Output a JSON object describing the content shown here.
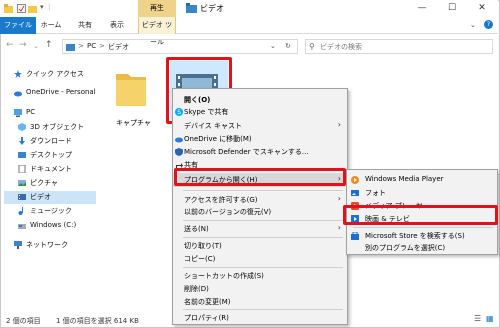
{
  "window": {
    "title": "ビデオ",
    "context_tab": "再生",
    "controls": [
      "—",
      "☐",
      "✕"
    ]
  },
  "ribbon": {
    "tabs": [
      "ファイル",
      "ホーム",
      "共有",
      "表示",
      "ビデオ ツール"
    ],
    "help": "?"
  },
  "address": {
    "path": [
      "PC",
      "ビデオ"
    ],
    "separator": ">",
    "search_placeholder": "ビデオの検索"
  },
  "sidebar": {
    "items": [
      {
        "label": "クイック アクセス",
        "icon": "star-icon"
      },
      {
        "label": "OneDrive - Personal",
        "icon": "cloud-icon"
      },
      {
        "label": "PC",
        "icon": "pc-icon"
      },
      {
        "label": "3D オブジェクト",
        "icon": "cube-icon"
      },
      {
        "label": "ダウンロード",
        "icon": "download-icon"
      },
      {
        "label": "デスクトップ",
        "icon": "desktop-icon"
      },
      {
        "label": "ドキュメント",
        "icon": "document-icon"
      },
      {
        "label": "ピクチャ",
        "icon": "picture-icon"
      },
      {
        "label": "ビデオ",
        "icon": "video-icon"
      },
      {
        "label": "ミュージック",
        "icon": "music-icon"
      },
      {
        "label": "Windows (C:)",
        "icon": "drive-icon"
      },
      {
        "label": "ネットワーク",
        "icon": "network-icon"
      }
    ]
  },
  "files": {
    "folder_label": "キャプチャ"
  },
  "status": {
    "count": "2 個の項目",
    "selected": "1 個の項目を選択  614 KB"
  },
  "context_menu": {
    "items": [
      {
        "label": "開く(O)",
        "bold": true
      },
      {
        "label": "Skype で共有",
        "icon": "skype-icon"
      },
      {
        "label": "デバイス キャスト",
        "arrow": true
      },
      {
        "label": "OneDrive に移動(M)",
        "icon": "onedrive-icon"
      },
      {
        "label": "Microsoft Defender でスキャンする...",
        "icon": "defender-icon"
      },
      {
        "label": "共有",
        "icon": "share-icon"
      },
      {
        "label": "プログラムから開く(H)",
        "arrow": true
      },
      {
        "label": "アクセスを許可する(G)",
        "arrow": true
      },
      {
        "label": "以前のバージョンの復元(V)"
      },
      {
        "label": "送る(N)",
        "arrow": true
      },
      {
        "label": "切り取り(T)"
      },
      {
        "label": "コピー(C)"
      },
      {
        "label": "ショートカットの作成(S)"
      },
      {
        "label": "削除(D)"
      },
      {
        "label": "名前の変更(M)"
      },
      {
        "label": "プロパティ(R)"
      }
    ]
  },
  "submenu": {
    "items": [
      {
        "label": "Windows Media Player",
        "icon": "media-player-icon"
      },
      {
        "label": "フォト",
        "icon": "photos-icon"
      },
      {
        "label": "メディア プレーヤー",
        "icon": "media-icon"
      },
      {
        "label": "映画 & テレビ",
        "icon": "movies-tv-icon"
      },
      {
        "label": "Microsoft Store を検索する(S)",
        "icon": "store-icon"
      },
      {
        "label": "別のプログラムを選択(C)"
      }
    ]
  },
  "colors": {
    "accent": "#1979ca",
    "highlight": "#e0121b",
    "selection": "#cce4f7"
  }
}
